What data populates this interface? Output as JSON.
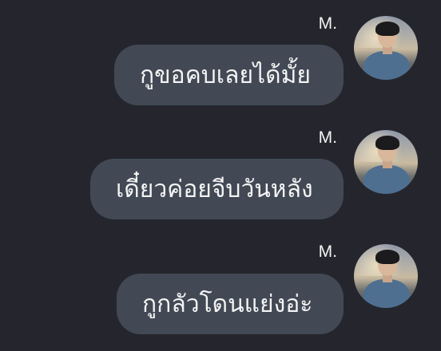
{
  "messages": [
    {
      "sender": "M.",
      "text": "กูขอคบเลยได้มั้ย"
    },
    {
      "sender": "M.",
      "text": "เดี๋ยวค่อยจีบวันหลัง"
    },
    {
      "sender": "M.",
      "text": "กูกลัวโดนแย่งอ่ะ"
    }
  ],
  "colors": {
    "background": "#25262d",
    "bubble": "#424955",
    "text": "#f4f4f4"
  }
}
